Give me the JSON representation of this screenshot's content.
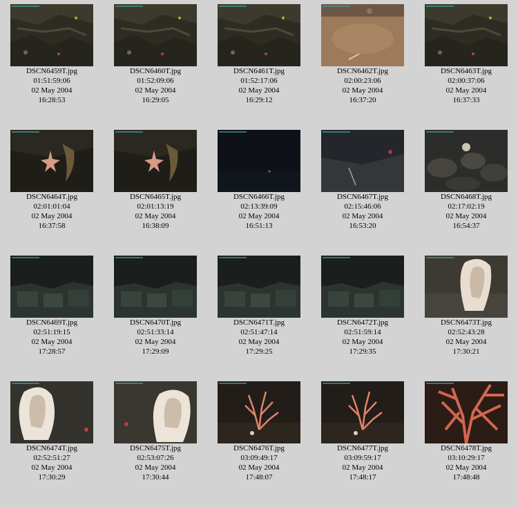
{
  "thumbnails": [
    {
      "file": "DSCN6459T.jpg",
      "elapsed": "01:51:59:06",
      "date": "02 May 2004",
      "time": "16:28:53",
      "scene": "rock-dark"
    },
    {
      "file": "DSCN6460T.jpg",
      "elapsed": "01:52:09:06",
      "date": "02 May 2004",
      "time": "16:29:05",
      "scene": "rock-dark"
    },
    {
      "file": "DSCN6461T.jpg",
      "elapsed": "01:52:17:06",
      "date": "02 May 2004",
      "time": "16:29:12",
      "scene": "rock-dark"
    },
    {
      "file": "DSCN6462T.jpg",
      "elapsed": "02:00:23:06",
      "date": "02 May 2004",
      "time": "16:37:20",
      "scene": "sand"
    },
    {
      "file": "DSCN6463T.jpg",
      "elapsed": "02:00:37:06",
      "date": "02 May 2004",
      "time": "16:37:33",
      "scene": "rock-dark"
    },
    {
      "file": "DSCN6464T.jpg",
      "elapsed": "02:01:01:04",
      "date": "02 May 2004",
      "time": "16:37:58",
      "scene": "starfish"
    },
    {
      "file": "DSCN6465T.jpg",
      "elapsed": "02:01:13:19",
      "date": "02 May 2004",
      "time": "16:38:09",
      "scene": "starfish"
    },
    {
      "file": "DSCN6466T.jpg",
      "elapsed": "02:13:39:09",
      "date": "02 May 2004",
      "time": "16:51:13",
      "scene": "night"
    },
    {
      "file": "DSCN6467T.jpg",
      "elapsed": "02:15:46:06",
      "date": "02 May 2004",
      "time": "16:53:20",
      "scene": "slope"
    },
    {
      "file": "DSCN6468T.jpg",
      "elapsed": "02:17:02:19",
      "date": "02 May 2004",
      "time": "16:54:37",
      "scene": "boulders"
    },
    {
      "file": "DSCN6469T.jpg",
      "elapsed": "02:51:19:15",
      "date": "02 May 2004",
      "time": "17:28:57",
      "scene": "blocks"
    },
    {
      "file": "DSCN6470T.jpg",
      "elapsed": "02:51:33:14",
      "date": "02 May 2004",
      "time": "17:29:09",
      "scene": "blocks"
    },
    {
      "file": "DSCN6471T.jpg",
      "elapsed": "02:51:47:14",
      "date": "02 May 2004",
      "time": "17:29:25",
      "scene": "blocks"
    },
    {
      "file": "DSCN6472T.jpg",
      "elapsed": "02:51:59:14",
      "date": "02 May 2004",
      "time": "17:29:35",
      "scene": "blocks"
    },
    {
      "file": "DSCN6473T.jpg",
      "elapsed": "02:52:43:28",
      "date": "02 May 2004",
      "time": "17:30:21",
      "scene": "sponge-right"
    },
    {
      "file": "DSCN6474T.jpg",
      "elapsed": "02:52:51:27",
      "date": "02 May 2004",
      "time": "17:30:29",
      "scene": "sponge-left"
    },
    {
      "file": "DSCN6475T.jpg",
      "elapsed": "02:53:07:26",
      "date": "02 May 2004",
      "time": "17:30:44",
      "scene": "sponge-right2"
    },
    {
      "file": "DSCN6476T.jpg",
      "elapsed": "03:09:49:17",
      "date": "02 May 2004",
      "time": "17:48:07",
      "scene": "coral-small"
    },
    {
      "file": "DSCN6477T.jpg",
      "elapsed": "03:09:59:17",
      "date": "02 May 2004",
      "time": "17:48:17",
      "scene": "coral-small"
    },
    {
      "file": "DSCN6478T.jpg",
      "elapsed": "03:10:29:17",
      "date": "02 May 2004",
      "time": "17:48:48",
      "scene": "coral-big"
    }
  ],
  "colors": {
    "background": "#d3d3d3",
    "caption": "#000000"
  }
}
